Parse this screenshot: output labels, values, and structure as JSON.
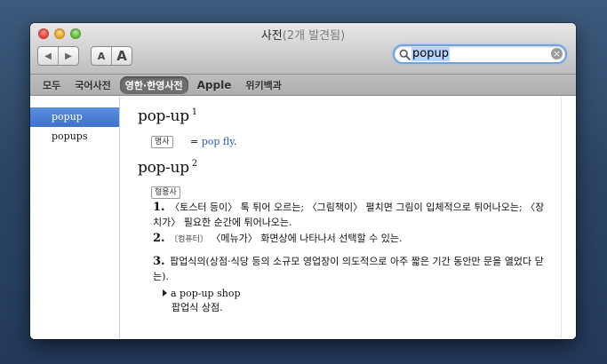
{
  "window": {
    "title": "사전",
    "count": "(2개 발견됨)"
  },
  "toolbar": {
    "back_label": "◀",
    "forward_label": "▶",
    "font_smaller_label": "A",
    "font_larger_label": "A"
  },
  "search": {
    "value": "popup",
    "clear_label": "×"
  },
  "scopes": [
    {
      "label": "모두"
    },
    {
      "label": "국어사전"
    },
    {
      "label": "영한·한영사전"
    },
    {
      "label": "Apple"
    },
    {
      "label": "위키백과"
    }
  ],
  "selected_scope": "영한·한영사전",
  "sidebar": {
    "items": [
      {
        "label": "popup"
      },
      {
        "label": "popups"
      }
    ]
  },
  "entry1": {
    "headword": "pop-up",
    "sup": "1",
    "pos": "명사",
    "xref_eq": "=",
    "xref_link": "pop fly",
    "xref_end": "."
  },
  "entry2": {
    "headword": "pop-up",
    "sup": "2",
    "pos": "형용사",
    "senses": [
      {
        "num": "1.",
        "text": "〈토스터 등이〉 톡 튀어 오르는; 〈그림책이〉 펼치면 그림이 입체적으로 튀어나오는; 〈장치가〉 필요한 순간에 튀어나오는."
      },
      {
        "num": "2.",
        "tag": "〔컴퓨터〕",
        "text": "〈메뉴가〉 화면상에 나타나서 선택할 수 있는."
      },
      {
        "num": "3.",
        "text": "팝업식의(상점·식당 등의 소규모 영업장이 의도적으로 아주 짧은 기간 동안만 문을 열었다 닫는)."
      }
    ],
    "example_en": "a pop-up shop",
    "example_ko": "팝업식 상점."
  },
  "colors": {
    "selection": "#3f72cc",
    "link": "#2a5db0",
    "search_focus": "#6ea3df"
  }
}
